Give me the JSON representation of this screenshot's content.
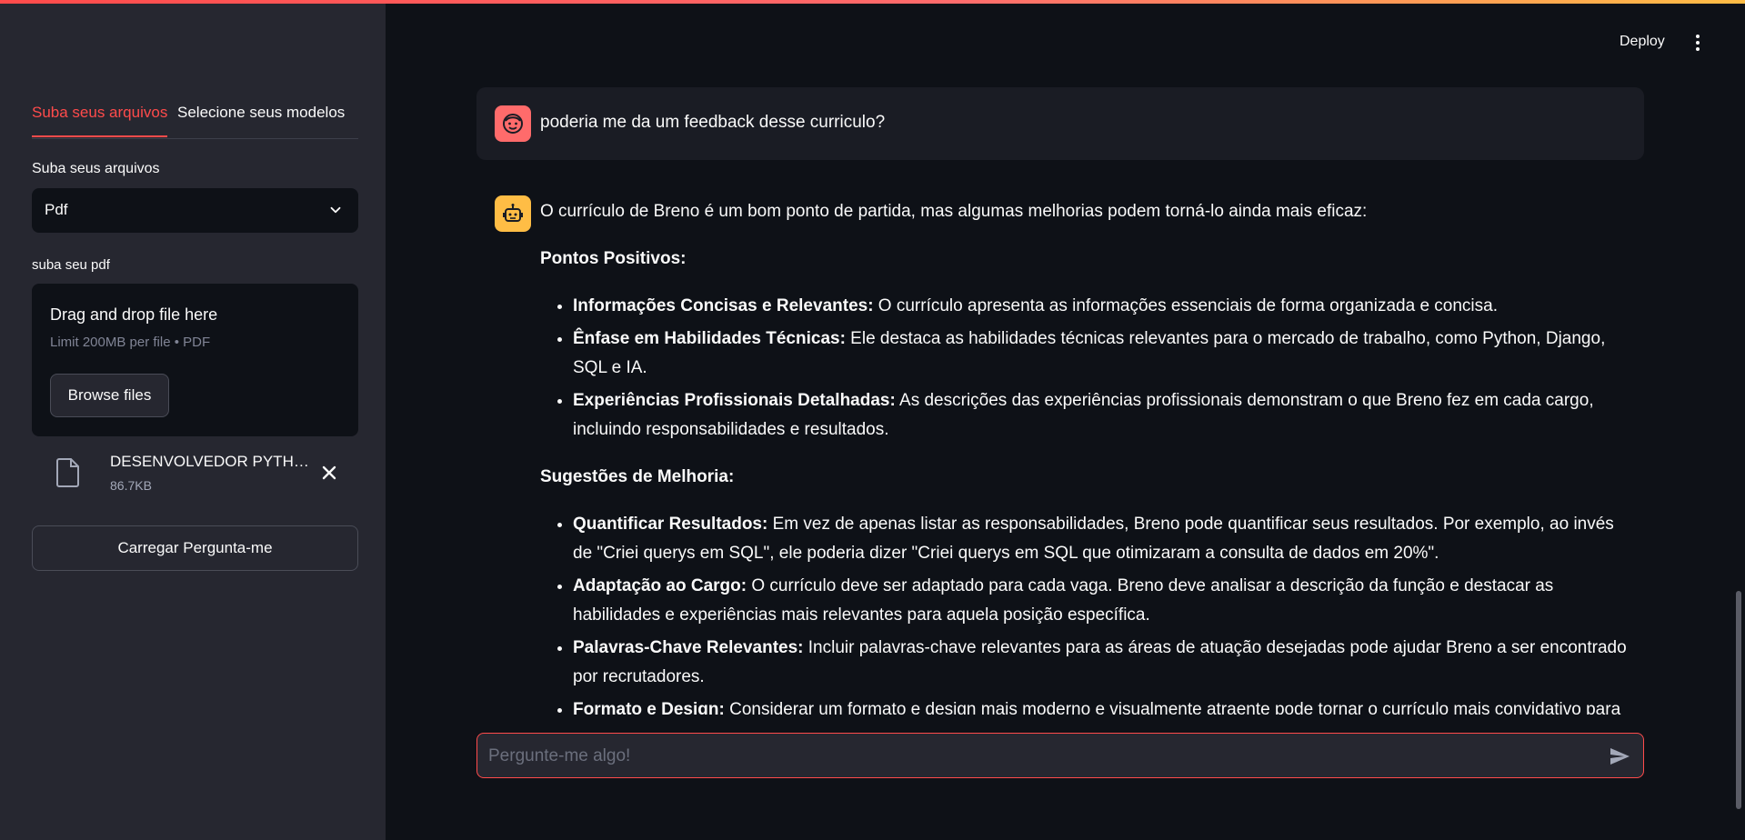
{
  "sidebar": {
    "tabs": [
      {
        "label": "Suba seus arquivos",
        "active": true
      },
      {
        "label": "Selecione seus modelos",
        "active": false
      }
    ],
    "upload_label": "Suba seus arquivos",
    "select_value": "Pdf",
    "pdf_label": "suba seu pdf",
    "dropzone": {
      "title": "Drag and drop file here",
      "subtitle": "Limit 200MB per file • PDF",
      "browse_label": "Browse files"
    },
    "file": {
      "name": "DESENVOLVEDOR PYTHON.pdf",
      "size": "86.7KB"
    },
    "load_button": "Carregar Pergunta-me"
  },
  "header": {
    "deploy_label": "Deploy",
    "menu_icon": "kebab-menu-icon"
  },
  "chat": {
    "user_message": "poderia me da um feedback desse curriculo?",
    "bot": {
      "intro": "O currículo de Breno é um bom ponto de partida, mas algumas melhorias podem torná-lo ainda mais eficaz:",
      "positives_heading": "Pontos Positivos:",
      "positives": [
        {
          "title": "Informações Concisas e Relevantes:",
          "text": " O currículo apresenta as informações essenciais de forma organizada e concisa."
        },
        {
          "title": "Ênfase em Habilidades Técnicas:",
          "text": " Ele destaca as habilidades técnicas relevantes para o mercado de trabalho, como Python, Django, SQL e IA."
        },
        {
          "title": "Experiências Profissionais Detalhadas:",
          "text": " As descrições das experiências profissionais demonstram o que Breno fez em cada cargo, incluindo responsabilidades e resultados."
        }
      ],
      "suggestions_heading": "Sugestões de Melhoria:",
      "suggestions": [
        {
          "title": "Quantificar Resultados:",
          "text": " Em vez de apenas listar as responsabilidades, Breno pode quantificar seus resultados. Por exemplo, ao invés de \"Criei querys em SQL\", ele poderia dizer \"Criei querys em SQL que otimizaram a consulta de dados em 20%\"."
        },
        {
          "title": "Adaptação ao Cargo:",
          "text": " O currículo deve ser adaptado para cada vaga. Breno deve analisar a descrição da função e destacar as habilidades e experiências mais relevantes para aquela posição específica."
        },
        {
          "title": "Palavras-Chave Relevantes:",
          "text": " Incluir palavras-chave relevantes para as áreas de atuação desejadas pode ajudar Breno a ser encontrado por recrutadores."
        },
        {
          "title": "Formato e Design:",
          "text": " Considerar um formato e design mais moderno e visualmente atraente pode tornar o currículo mais convidativo para os recrutadores."
        }
      ]
    },
    "input_placeholder": "Pergunte-me algo!"
  },
  "colors": {
    "accent": "#ff4b4b",
    "bot_avatar": "#ffbd45",
    "user_avatar": "#ff6b6b",
    "background": "#0e1117",
    "sidebar": "#262730"
  }
}
